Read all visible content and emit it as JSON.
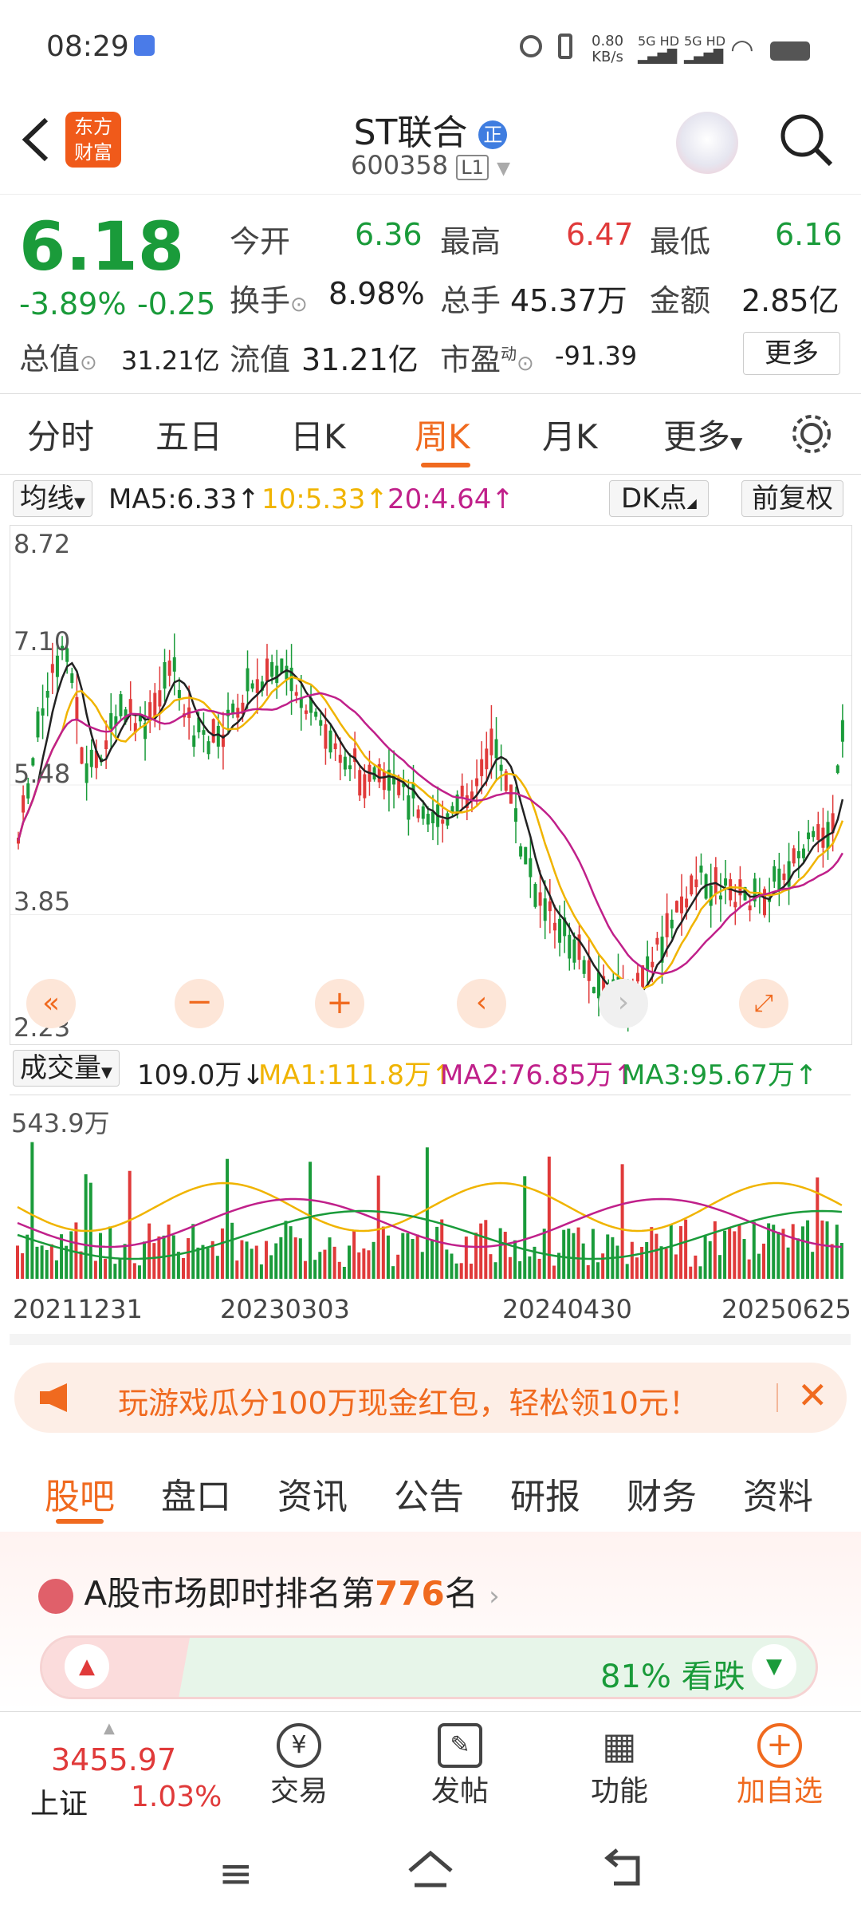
{
  "status": {
    "time": "08:29",
    "net_speed": "0.80",
    "net_unit": "KB/s"
  },
  "header": {
    "title": "ST联合",
    "code": "600358",
    "level": "L1",
    "logo_text": "东方财富",
    "badge": "正"
  },
  "quote": {
    "price": "6.18",
    "change_pct": "-3.89%",
    "change": "-0.25",
    "open_label": "今开",
    "open": "6.36",
    "high_label": "最高",
    "high": "6.47",
    "low_label": "最低",
    "low": "6.16",
    "turnover_label": "换手",
    "turnover": "8.98%",
    "volume_label": "总手",
    "volume": "45.37万",
    "amount_label": "金额",
    "amount": "2.85亿",
    "mktcap_label": "总值",
    "mktcap": "31.21亿",
    "float_label": "流值",
    "float": "31.21亿",
    "pe_label": "市盈",
    "pe_sup": "动",
    "pe": "-91.39",
    "more_label": "更多"
  },
  "tabs": [
    "分时",
    "五日",
    "日K",
    "周K",
    "月K",
    "更多"
  ],
  "active_tab": "周K",
  "ma": {
    "label": "均线",
    "ma5": "MA5:6.33",
    "ma10": "10:5.33",
    "ma20": "20:4.64",
    "dk": "DK点",
    "adjust": "前复权"
  },
  "price_axis": [
    "8.72",
    "7.10",
    "5.48",
    "3.85",
    "2.23"
  ],
  "vol": {
    "label": "成交量",
    "value": "109.0万",
    "ma1": "MA1:111.8万",
    "ma2": "MA2:76.85万",
    "ma3": "MA3:95.67万",
    "axis_max": "543.9万"
  },
  "dates": [
    "20211231",
    "20230303",
    "20240430",
    "20250625"
  ],
  "banner": {
    "text": "玩游戏瓜分100万现金红包，轻松领10元！"
  },
  "feed_tabs": [
    "股吧",
    "盘口",
    "资讯",
    "公告",
    "研报",
    "财务",
    "资料"
  ],
  "active_feed_tab": "股吧",
  "rank": {
    "prefix": "A股市场即时排名第",
    "number": "776",
    "suffix": "名",
    "sentiment": "81% 看跌"
  },
  "bottom": {
    "index_value": "3455.97",
    "index_name": "上证",
    "index_change": "1.03%",
    "trade": "交易",
    "post": "发帖",
    "func": "功能",
    "add": "加自选"
  },
  "colors": {
    "up": "#e03a3a",
    "down": "#1a9b3a",
    "accent": "#f06a1f",
    "ma5": "#222222",
    "ma10": "#f0b400",
    "ma20": "#c0208a",
    "ma3": "#1a9b3a"
  }
}
